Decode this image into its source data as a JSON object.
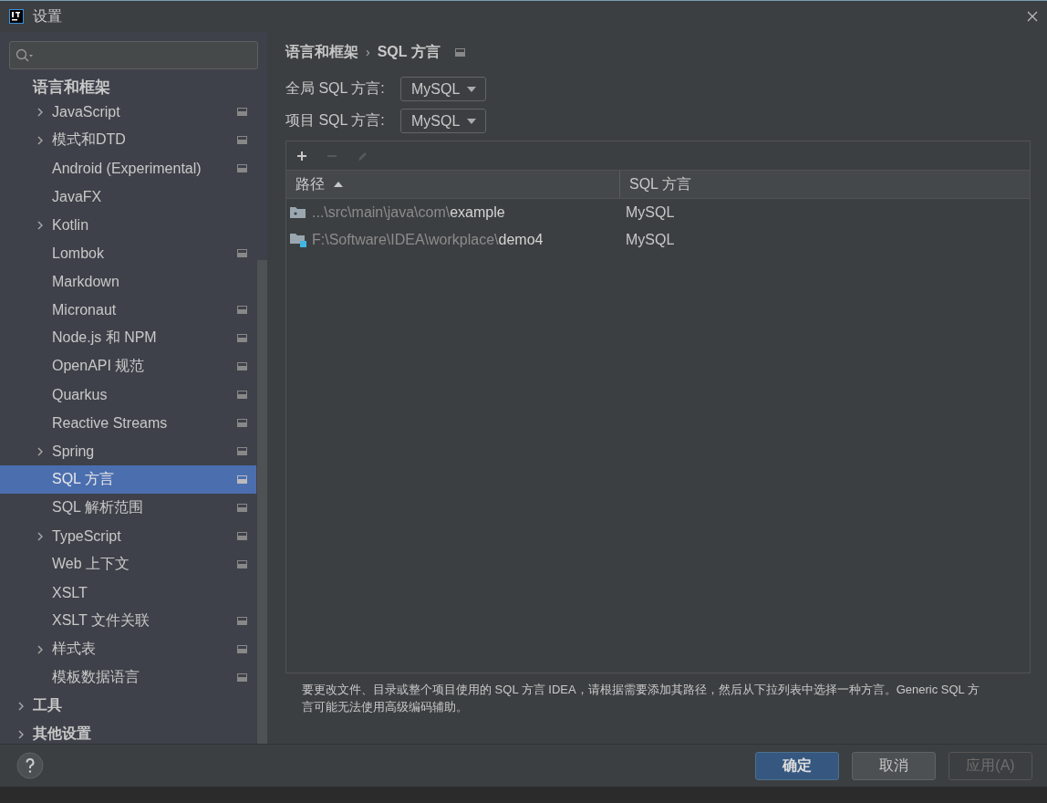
{
  "window": {
    "title": "设置"
  },
  "sidebar": {
    "section": "语言和框架",
    "items": [
      {
        "label": "JavaScript",
        "expandable": true,
        "project_icon": true,
        "selected": false
      },
      {
        "label": "模式和DTD",
        "expandable": true,
        "project_icon": true,
        "selected": false
      },
      {
        "label": "Android (Experimental)",
        "expandable": false,
        "project_icon": true,
        "selected": false
      },
      {
        "label": "JavaFX",
        "expandable": false,
        "project_icon": false,
        "selected": false
      },
      {
        "label": "Kotlin",
        "expandable": true,
        "project_icon": false,
        "selected": false
      },
      {
        "label": "Lombok",
        "expandable": false,
        "project_icon": true,
        "selected": false
      },
      {
        "label": "Markdown",
        "expandable": false,
        "project_icon": false,
        "selected": false
      },
      {
        "label": "Micronaut",
        "expandable": false,
        "project_icon": true,
        "selected": false
      },
      {
        "label": "Node.js 和 NPM",
        "expandable": false,
        "project_icon": true,
        "selected": false
      },
      {
        "label": "OpenAPI 规范",
        "expandable": false,
        "project_icon": true,
        "selected": false
      },
      {
        "label": "Quarkus",
        "expandable": false,
        "project_icon": true,
        "selected": false
      },
      {
        "label": "Reactive Streams",
        "expandable": false,
        "project_icon": true,
        "selected": false
      },
      {
        "label": "Spring",
        "expandable": true,
        "project_icon": true,
        "selected": false
      },
      {
        "label": "SQL 方言",
        "expandable": false,
        "project_icon": true,
        "selected": true
      },
      {
        "label": "SQL 解析范围",
        "expandable": false,
        "project_icon": true,
        "selected": false
      },
      {
        "label": "TypeScript",
        "expandable": true,
        "project_icon": true,
        "selected": false
      },
      {
        "label": "Web 上下文",
        "expandable": false,
        "project_icon": true,
        "selected": false
      },
      {
        "label": "XSLT",
        "expandable": false,
        "project_icon": false,
        "selected": false
      },
      {
        "label": "XSLT 文件关联",
        "expandable": false,
        "project_icon": true,
        "selected": false
      },
      {
        "label": "样式表",
        "expandable": true,
        "project_icon": true,
        "selected": false
      },
      {
        "label": "模板数据语言",
        "expandable": false,
        "project_icon": true,
        "selected": false
      }
    ],
    "groups": [
      {
        "label": "工具"
      },
      {
        "label": "其他设置"
      }
    ]
  },
  "breadcrumb": {
    "parent": "语言和框架",
    "separator": "›",
    "current": "SQL 方言"
  },
  "fields": [
    {
      "label": "全局 SQL 方言:",
      "value": "MySQL"
    },
    {
      "label": "项目 SQL 方言:",
      "value": "MySQL"
    }
  ],
  "toolbar": [
    {
      "kind": "add",
      "disabled": false
    },
    {
      "kind": "remove",
      "disabled": true
    },
    {
      "kind": "edit",
      "disabled": true
    }
  ],
  "table": {
    "columns": [
      {
        "label": "路径",
        "sorted": true
      },
      {
        "label": "SQL 方言",
        "sorted": false
      }
    ],
    "rows": [
      {
        "kind": "folder",
        "path_prefix": "...\\src\\main\\java\\com\\",
        "path_name": "example",
        "dialect": "MySQL"
      },
      {
        "kind": "module",
        "path_prefix": "F:\\Software\\IDEA\\workplace\\",
        "path_name": "demo4",
        "dialect": "MySQL"
      }
    ]
  },
  "help_text": "要更改文件、目录或整个项目使用的 SQL 方言 IDEA，请根据需要添加其路径，然后从下拉列表中选择一种方言。Generic SQL 方言可能无法使用高级编码辅助。",
  "buttons": [
    {
      "label": "确定",
      "kind": "primary",
      "disabled": false
    },
    {
      "label": "取消",
      "kind": "normal",
      "disabled": false
    },
    {
      "label": "应用(A)",
      "kind": "normal",
      "disabled": true
    }
  ]
}
